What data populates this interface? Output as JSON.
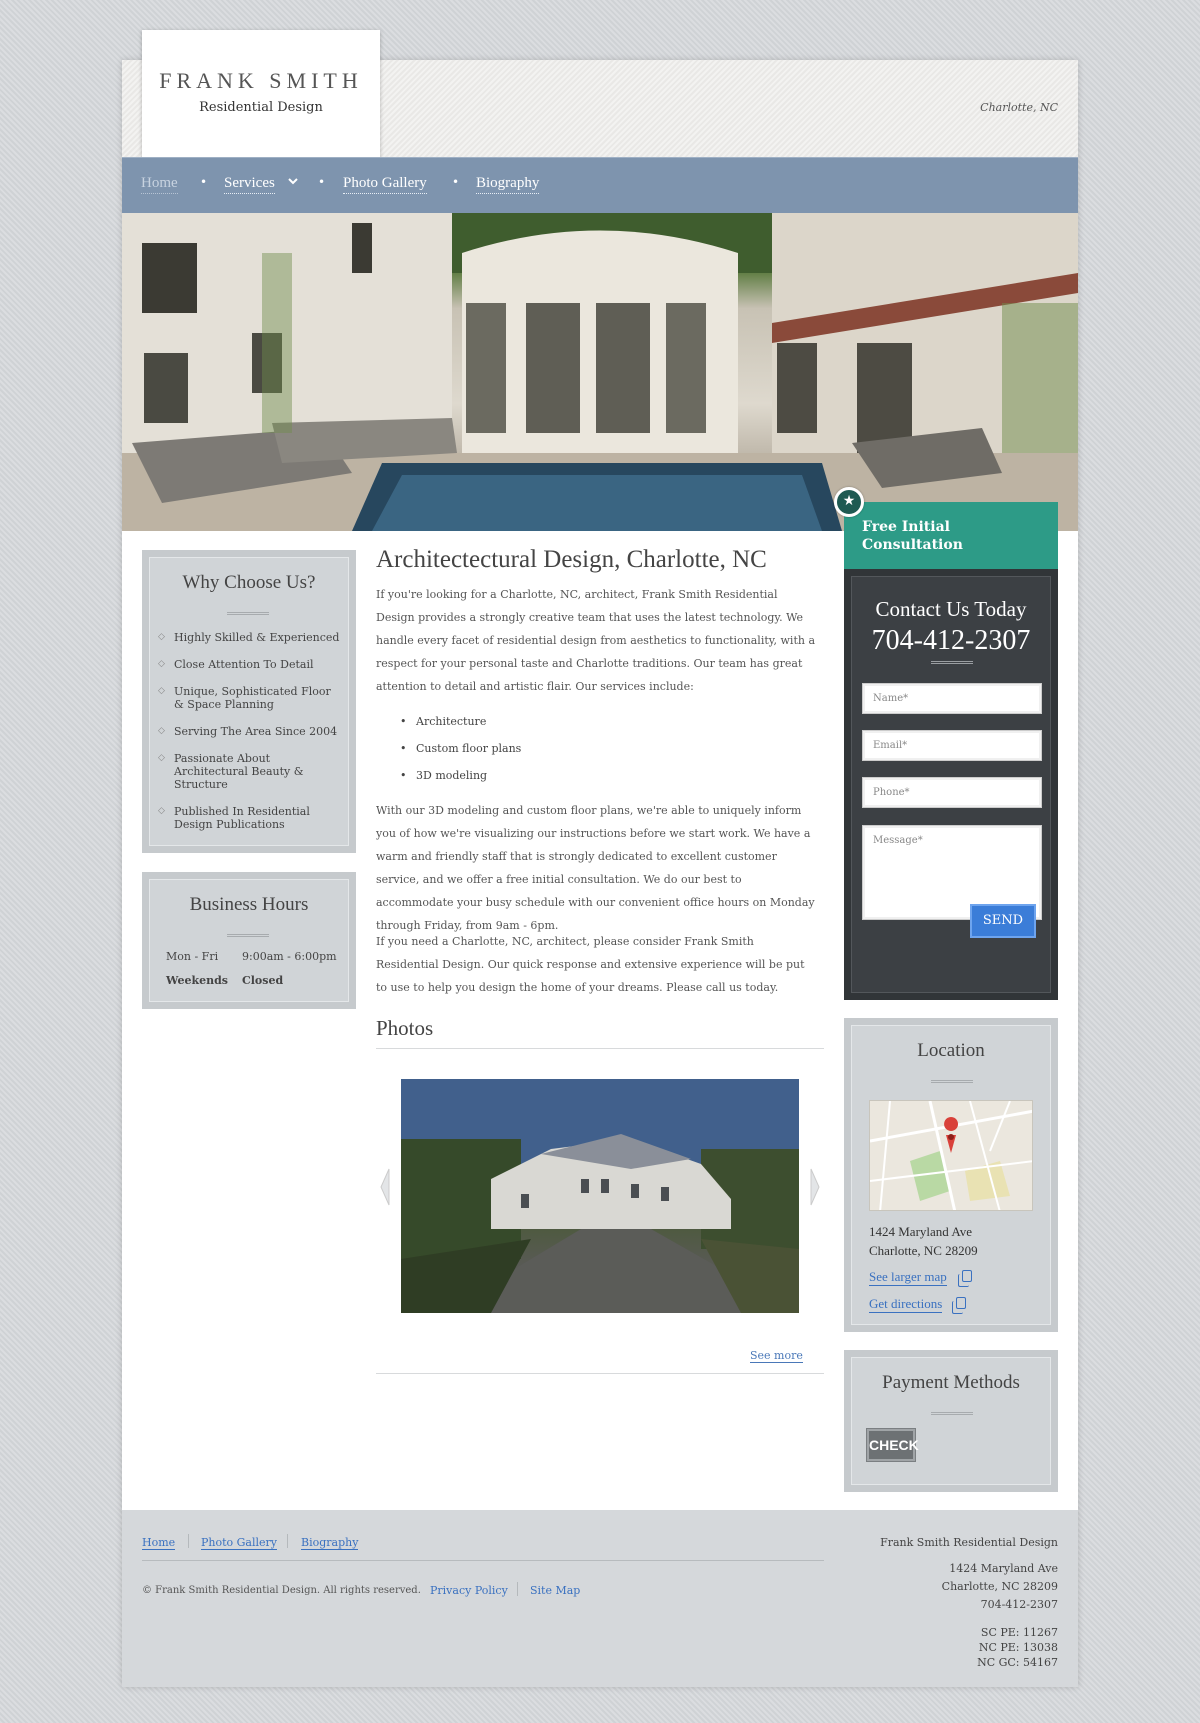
{
  "header": {
    "logo_name": "FRANK SMITH",
    "logo_tagline": "Residential Design",
    "location": "Charlotte, NC"
  },
  "nav": {
    "items": [
      {
        "label": "Home"
      },
      {
        "label": "Services"
      },
      {
        "label": "Photo Gallery"
      },
      {
        "label": "Biography"
      }
    ]
  },
  "why_choose": {
    "title": "Why Choose Us?",
    "items": [
      "Highly Skilled & Experienced",
      "Close Attention To Detail",
      "Unique, Sophisticated Floor & Space Planning",
      "Serving The Area Since 2004",
      "Passionate About Architectural Beauty & Structure",
      "Published In Residential Design Publications"
    ]
  },
  "hours": {
    "title": "Business Hours",
    "rows": [
      {
        "day": "Mon - Fri",
        "time": "9:00am - 6:00pm"
      },
      {
        "day": "Weekends",
        "time": "Closed"
      }
    ]
  },
  "main": {
    "title": "Architectectural Design, Charlotte, NC",
    "intro": "If you're looking for a Charlotte, NC, architect, Frank Smith Residential Design provides a strongly creative team that uses the latest technology. We handle every facet of residential design from aesthetics to functionality, with a respect for your personal taste and Charlotte traditions. Our team has great attention to detail and artistic flair. Our services include:",
    "services": [
      "Architecture",
      "Custom floor plans",
      "3D modeling"
    ],
    "para2": "With our 3D modeling and custom floor plans, we're able to uniquely inform you of how we're visualizing our instructions before we start work. We have a warm and friendly staff that is strongly dedicated to excellent customer service, and we offer a free initial consultation. We do our best to accommodate your busy schedule with our convenient office hours on Monday through Friday, from 9am - 6pm.",
    "para3": "If you need a Charlotte, NC, architect, please consider Frank Smith Residential Design. Our quick response and extensive experience will be put to use to help you design the home of your dreams. Please call us today.",
    "photos_title": "Photos",
    "see_more": "See more"
  },
  "consult": {
    "tab_line1": "Free Initial",
    "tab_line2": "Consultation",
    "contact_title": "Contact Us Today",
    "phone": "704-412-2307",
    "fields": {
      "name": "Name*",
      "email": "Email*",
      "phone": "Phone*",
      "message": "Message*"
    },
    "send_label": "SEND"
  },
  "location": {
    "title": "Location",
    "address1": "1424 Maryland Ave",
    "address2": "Charlotte, NC 28209",
    "larger_map": "See larger map",
    "directions": "Get directions"
  },
  "payment": {
    "title": "Payment Methods",
    "check_label": "CHECK"
  },
  "footer": {
    "links": [
      "Home",
      "Photo Gallery",
      "Biography"
    ],
    "copyright": "© Frank Smith Residential Design. All rights reserved.",
    "privacy": "Privacy Policy",
    "sitemap": "Site Map",
    "company": "Frank Smith Residential Design",
    "addr1": "1424 Maryland Ave",
    "addr2": "Charlotte, NC 28209",
    "phone": "704-412-2307",
    "license1": "SC PE: 11267",
    "license2": "NC PE: 13038",
    "license3": "NC GC: 54167"
  },
  "colors": {
    "nav": "#7e94ae",
    "accent_teal": "#2d9b87",
    "link": "#3a71c0",
    "send_button": "#3b7dd8"
  }
}
